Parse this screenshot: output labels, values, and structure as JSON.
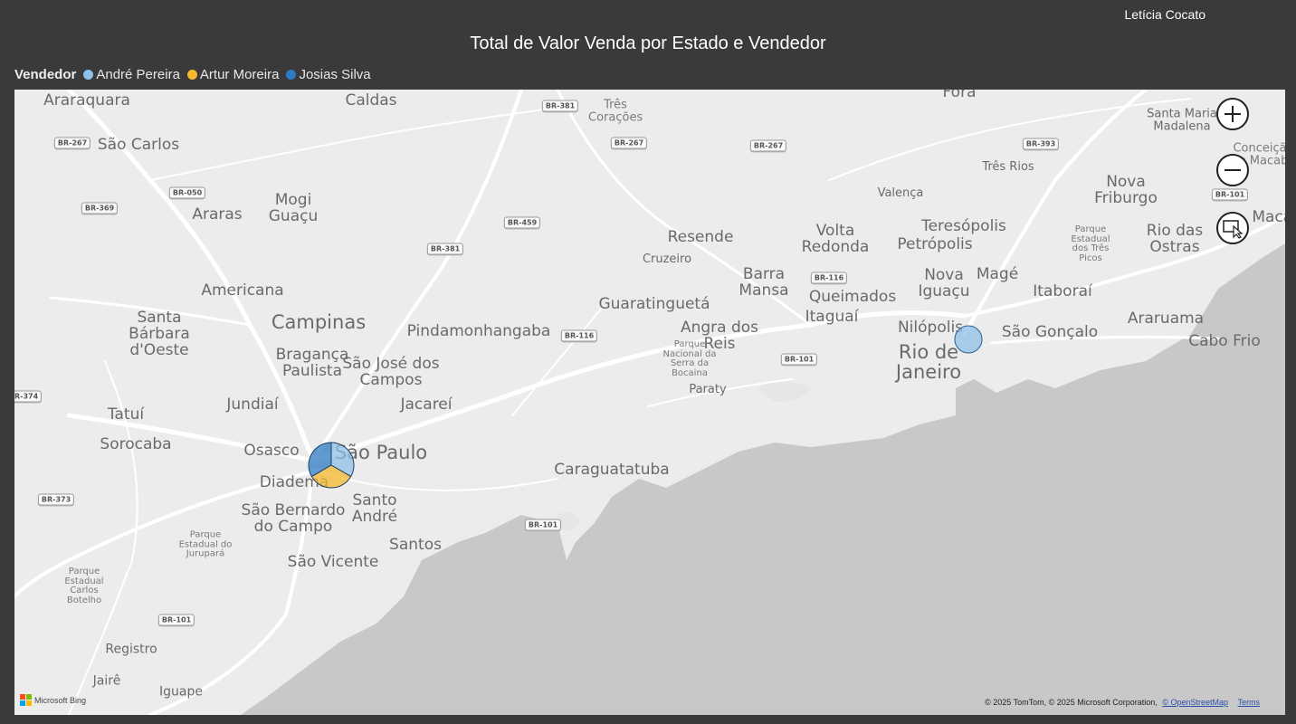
{
  "header": {
    "user_name": "Letícia Cocato"
  },
  "visual": {
    "title": "Total de Valor Venda por Estado e Vendedor"
  },
  "legend": {
    "title": "Vendedor",
    "items": [
      {
        "label": "André Pereira",
        "color": "#8fc1ea"
      },
      {
        "label": "Artur Moreira",
        "color": "#f5b82e"
      },
      {
        "label": "Josias Silva",
        "color": "#2e7bc4"
      }
    ]
  },
  "map": {
    "cities": [
      "Araraquara",
      "Caldas",
      "Três Corações",
      "Fora",
      "Santa Maria Madalena",
      "São Carlos",
      "Conceição de Macabu",
      "Três Rios",
      "Nova Friburgo",
      "Valença",
      "Mogi Guaçu",
      "Araras",
      "Teresópolis",
      "Petrópolis",
      "Rio das Ostras",
      "Volta Redonda",
      "Resende",
      "Cruzeiro",
      "Macaé",
      "Americana",
      "Barra Mansa",
      "Nova Iguaçu",
      "Magé",
      "Itaboraí",
      "Campinas",
      "Guaratinguetá",
      "Queimados",
      "Santa Bárbara d'Oeste",
      "Itaguaí",
      "Pindamonhangaba",
      "Angra dos Reis",
      "Nilópolis",
      "São Gonçalo",
      "Araruama",
      "Cabo Frio",
      "Rio de Janeiro",
      "Bragança Paulista",
      "São José dos Campos",
      "Paraty",
      "Jundiaí",
      "Jacareí",
      "Tatuí",
      "Sorocaba",
      "Osasco",
      "São Paulo",
      "Caraguatatuba",
      "Diadema",
      "Santo André",
      "São Bernardo do Campo",
      "Santos",
      "São Vicente",
      "Registro",
      "Jairê",
      "Iguape"
    ],
    "parks": [
      "Parque Estadual dos Três Picos",
      "Parque Nacional da Serra da Bocaina",
      "Parque Estadual do Jurupará",
      "Parque Estadual Carlos Botelho"
    ],
    "roads": [
      "BR-381",
      "BR-267",
      "BR-050",
      "BR-369",
      "BR-459",
      "BR-393",
      "BR-101",
      "BR-116",
      "BR-374",
      "BR-373"
    ],
    "markers": [
      {
        "state": "São Paulo",
        "type": "pie",
        "slices": [
          {
            "vendedor": "André Pereira",
            "share": 0.3333
          },
          {
            "vendedor": "Artur Moreira",
            "share": 0.3333
          },
          {
            "vendedor": "Josias Silva",
            "share": 0.3334
          }
        ]
      },
      {
        "state": "Rio de Janeiro",
        "type": "pie",
        "slices": [
          {
            "vendedor": "André Pereira",
            "share": 1.0
          }
        ]
      }
    ],
    "controls": {
      "zoom_in": "plus-icon",
      "zoom_out": "minus-icon",
      "select": "select-area-icon"
    },
    "bing_label": "Microsoft Bing",
    "attribution": "© 2025 TomTom, © 2025 Microsoft Corporation,",
    "osm_link": "© OpenStreetMap",
    "terms_link": "Terms"
  }
}
